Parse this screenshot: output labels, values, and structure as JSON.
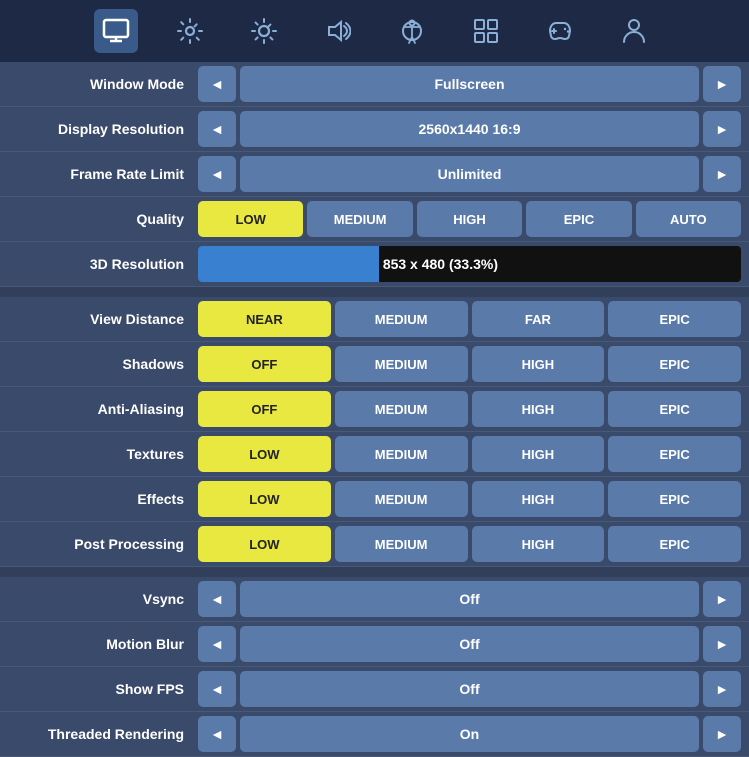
{
  "nav": {
    "icons": [
      {
        "id": "monitor",
        "label": "Display",
        "active": true,
        "symbol": "🖥"
      },
      {
        "id": "gear",
        "label": "Settings",
        "active": false,
        "symbol": "⚙"
      },
      {
        "id": "brightness",
        "label": "Brightness",
        "active": false,
        "symbol": "✦"
      },
      {
        "id": "sound",
        "label": "Sound",
        "active": false,
        "symbol": "🔊"
      },
      {
        "id": "accessibility",
        "label": "Accessibility",
        "active": false,
        "symbol": "⊕"
      },
      {
        "id": "network",
        "label": "Network",
        "active": false,
        "symbol": "⊞"
      },
      {
        "id": "gamepad",
        "label": "Gamepad",
        "active": false,
        "symbol": "⬡"
      },
      {
        "id": "user",
        "label": "User",
        "active": false,
        "symbol": "👤"
      }
    ]
  },
  "settings": {
    "window_mode": {
      "label": "Window Mode",
      "value": "Fullscreen"
    },
    "display_resolution": {
      "label": "Display Resolution",
      "value": "2560x1440 16:9"
    },
    "frame_rate_limit": {
      "label": "Frame Rate Limit",
      "value": "Unlimited"
    },
    "quality": {
      "label": "Quality",
      "options": [
        "LOW",
        "MEDIUM",
        "HIGH",
        "EPIC",
        "AUTO"
      ],
      "active": "LOW",
      "active_type": "yellow"
    },
    "resolution_3d": {
      "label": "3D Resolution",
      "value": "853 x 480 (33.3%)",
      "fill_percent": 33.3
    },
    "view_distance": {
      "label": "View Distance",
      "options": [
        "NEAR",
        "MEDIUM",
        "FAR",
        "EPIC"
      ],
      "active": "NEAR"
    },
    "shadows": {
      "label": "Shadows",
      "options": [
        "OFF",
        "MEDIUM",
        "HIGH",
        "EPIC"
      ],
      "active": "OFF"
    },
    "anti_aliasing": {
      "label": "Anti-Aliasing",
      "options": [
        "OFF",
        "MEDIUM",
        "HIGH",
        "EPIC"
      ],
      "active": "OFF"
    },
    "textures": {
      "label": "Textures",
      "options": [
        "LOW",
        "MEDIUM",
        "HIGH",
        "EPIC"
      ],
      "active": "LOW"
    },
    "effects": {
      "label": "Effects",
      "options": [
        "LOW",
        "MEDIUM",
        "HIGH",
        "EPIC"
      ],
      "active": "LOW"
    },
    "post_processing": {
      "label": "Post Processing",
      "options": [
        "LOW",
        "MEDIUM",
        "HIGH",
        "EPIC"
      ],
      "active": "LOW"
    },
    "vsync": {
      "label": "Vsync",
      "value": "Off"
    },
    "motion_blur": {
      "label": "Motion Blur",
      "value": "Off"
    },
    "show_fps": {
      "label": "Show FPS",
      "value": "Off"
    },
    "threaded_rendering": {
      "label": "Threaded Rendering",
      "value": "On"
    }
  },
  "labels": {
    "left_arrow": "◄",
    "right_arrow": "►"
  }
}
